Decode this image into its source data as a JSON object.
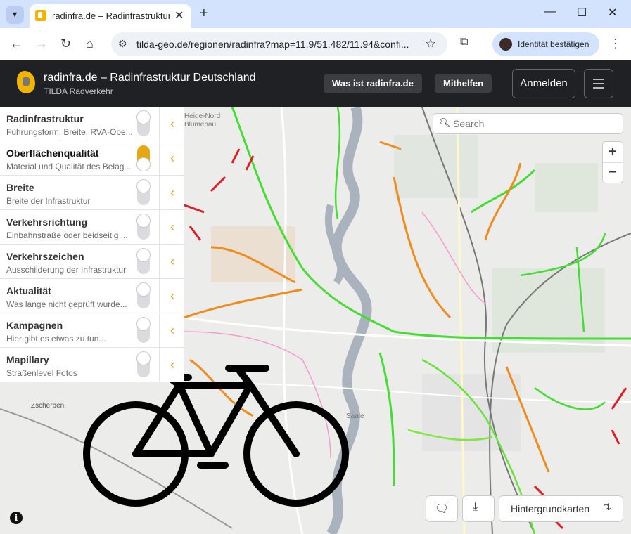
{
  "browser": {
    "tab_title": "radinfra.de – Radinfrastruktur D",
    "new_tab_symbol": "+",
    "url": "tilda-geo.de/regionen/radinfra?map=11.9/51.482/11.94&confi...",
    "profile_label": "Identität bestätigen"
  },
  "app": {
    "title": "radinfra.de – Radinfrastruktur Deutschland",
    "subtitle": "TILDA Radverkehr",
    "what_is_label": "Was ist radinfra.de",
    "help_label": "Mithelfen",
    "login_label": "Anmelden"
  },
  "layers": [
    {
      "title": "Radinfrastruktur",
      "desc": "Führungsform, Breite, RVA-Obe...",
      "on": false
    },
    {
      "title": "Oberflächenqualität",
      "desc": "Material und Qualität des Belag...",
      "on": true
    },
    {
      "title": "Breite",
      "desc": "Breite der Infrastruktur",
      "on": false
    },
    {
      "title": "Verkehrsrichtung",
      "desc": "Einbahnstraße oder beidseitig ...",
      "on": false
    },
    {
      "title": "Verkehrszeichen",
      "desc": "Ausschilderung der Infrastruktur",
      "on": false
    },
    {
      "title": "Aktualität",
      "desc": "Was lange nicht geprüft wurde...",
      "on": false
    },
    {
      "title": "Kampagnen",
      "desc": "Hier gibt es etwas zu tun...",
      "on": false
    },
    {
      "title": "Mapillary",
      "desc": "Straßenlevel Fotos",
      "on": false
    }
  ],
  "map": {
    "search_placeholder": "Search",
    "zoom_in": "+",
    "zoom_out": "−",
    "basemaps_label": "Hintergrundkarten",
    "label_zscherben": "Zscherben",
    "label_heide": "Heide-Nord",
    "label_blumenau": "Blumenau",
    "label_saale": "Saale",
    "info_symbol": "i"
  },
  "colors": {
    "accent": "#e5a713",
    "good": "#44dd33",
    "medium": "#f08c1e",
    "bad": "#e01c24",
    "appbar": "#202124"
  }
}
